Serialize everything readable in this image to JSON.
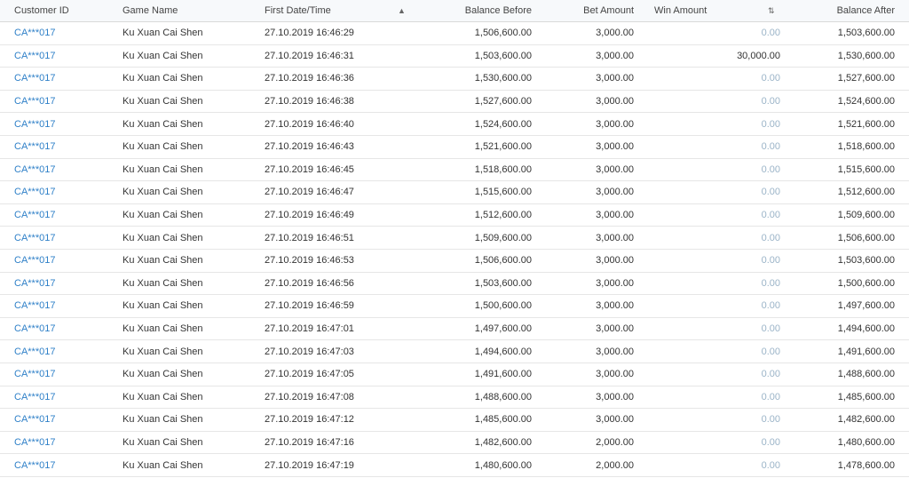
{
  "table": {
    "headers": {
      "customer_id": "Customer ID",
      "game_name": "Game Name",
      "first_date": "First Date/Time",
      "balance_before": "Balance Before",
      "bet_amount": "Bet Amount",
      "win_amount": "Win Amount",
      "balance_after": "Balance After"
    },
    "icons": {
      "date_sort": "chevron-up-icon",
      "win_sort": "sort-updown-icon"
    },
    "colors": {
      "link": "#2f80c8",
      "zero_value": "#9bb4c8"
    },
    "rows": [
      {
        "id": "CA***017",
        "game": "Ku Xuan Cai Shen",
        "date": "27.10.2019 16:46:29",
        "before": "1,506,600.00",
        "bet": "3,000.00",
        "win": "0.00",
        "after": "1,503,600.00"
      },
      {
        "id": "CA***017",
        "game": "Ku Xuan Cai Shen",
        "date": "27.10.2019 16:46:31",
        "before": "1,503,600.00",
        "bet": "3,000.00",
        "win": "30,000.00",
        "after": "1,530,600.00"
      },
      {
        "id": "CA***017",
        "game": "Ku Xuan Cai Shen",
        "date": "27.10.2019 16:46:36",
        "before": "1,530,600.00",
        "bet": "3,000.00",
        "win": "0.00",
        "after": "1,527,600.00"
      },
      {
        "id": "CA***017",
        "game": "Ku Xuan Cai Shen",
        "date": "27.10.2019 16:46:38",
        "before": "1,527,600.00",
        "bet": "3,000.00",
        "win": "0.00",
        "after": "1,524,600.00"
      },
      {
        "id": "CA***017",
        "game": "Ku Xuan Cai Shen",
        "date": "27.10.2019 16:46:40",
        "before": "1,524,600.00",
        "bet": "3,000.00",
        "win": "0.00",
        "after": "1,521,600.00"
      },
      {
        "id": "CA***017",
        "game": "Ku Xuan Cai Shen",
        "date": "27.10.2019 16:46:43",
        "before": "1,521,600.00",
        "bet": "3,000.00",
        "win": "0.00",
        "after": "1,518,600.00"
      },
      {
        "id": "CA***017",
        "game": "Ku Xuan Cai Shen",
        "date": "27.10.2019 16:46:45",
        "before": "1,518,600.00",
        "bet": "3,000.00",
        "win": "0.00",
        "after": "1,515,600.00"
      },
      {
        "id": "CA***017",
        "game": "Ku Xuan Cai Shen",
        "date": "27.10.2019 16:46:47",
        "before": "1,515,600.00",
        "bet": "3,000.00",
        "win": "0.00",
        "after": "1,512,600.00"
      },
      {
        "id": "CA***017",
        "game": "Ku Xuan Cai Shen",
        "date": "27.10.2019 16:46:49",
        "before": "1,512,600.00",
        "bet": "3,000.00",
        "win": "0.00",
        "after": "1,509,600.00"
      },
      {
        "id": "CA***017",
        "game": "Ku Xuan Cai Shen",
        "date": "27.10.2019 16:46:51",
        "before": "1,509,600.00",
        "bet": "3,000.00",
        "win": "0.00",
        "after": "1,506,600.00"
      },
      {
        "id": "CA***017",
        "game": "Ku Xuan Cai Shen",
        "date": "27.10.2019 16:46:53",
        "before": "1,506,600.00",
        "bet": "3,000.00",
        "win": "0.00",
        "after": "1,503,600.00"
      },
      {
        "id": "CA***017",
        "game": "Ku Xuan Cai Shen",
        "date": "27.10.2019 16:46:56",
        "before": "1,503,600.00",
        "bet": "3,000.00",
        "win": "0.00",
        "after": "1,500,600.00"
      },
      {
        "id": "CA***017",
        "game": "Ku Xuan Cai Shen",
        "date": "27.10.2019 16:46:59",
        "before": "1,500,600.00",
        "bet": "3,000.00",
        "win": "0.00",
        "after": "1,497,600.00"
      },
      {
        "id": "CA***017",
        "game": "Ku Xuan Cai Shen",
        "date": "27.10.2019 16:47:01",
        "before": "1,497,600.00",
        "bet": "3,000.00",
        "win": "0.00",
        "after": "1,494,600.00"
      },
      {
        "id": "CA***017",
        "game": "Ku Xuan Cai Shen",
        "date": "27.10.2019 16:47:03",
        "before": "1,494,600.00",
        "bet": "3,000.00",
        "win": "0.00",
        "after": "1,491,600.00"
      },
      {
        "id": "CA***017",
        "game": "Ku Xuan Cai Shen",
        "date": "27.10.2019 16:47:05",
        "before": "1,491,600.00",
        "bet": "3,000.00",
        "win": "0.00",
        "after": "1,488,600.00"
      },
      {
        "id": "CA***017",
        "game": "Ku Xuan Cai Shen",
        "date": "27.10.2019 16:47:08",
        "before": "1,488,600.00",
        "bet": "3,000.00",
        "win": "0.00",
        "after": "1,485,600.00"
      },
      {
        "id": "CA***017",
        "game": "Ku Xuan Cai Shen",
        "date": "27.10.2019 16:47:12",
        "before": "1,485,600.00",
        "bet": "3,000.00",
        "win": "0.00",
        "after": "1,482,600.00"
      },
      {
        "id": "CA***017",
        "game": "Ku Xuan Cai Shen",
        "date": "27.10.2019 16:47:16",
        "before": "1,482,600.00",
        "bet": "2,000.00",
        "win": "0.00",
        "after": "1,480,600.00"
      },
      {
        "id": "CA***017",
        "game": "Ku Xuan Cai Shen",
        "date": "27.10.2019 16:47:19",
        "before": "1,480,600.00",
        "bet": "2,000.00",
        "win": "0.00",
        "after": "1,478,600.00"
      }
    ]
  }
}
